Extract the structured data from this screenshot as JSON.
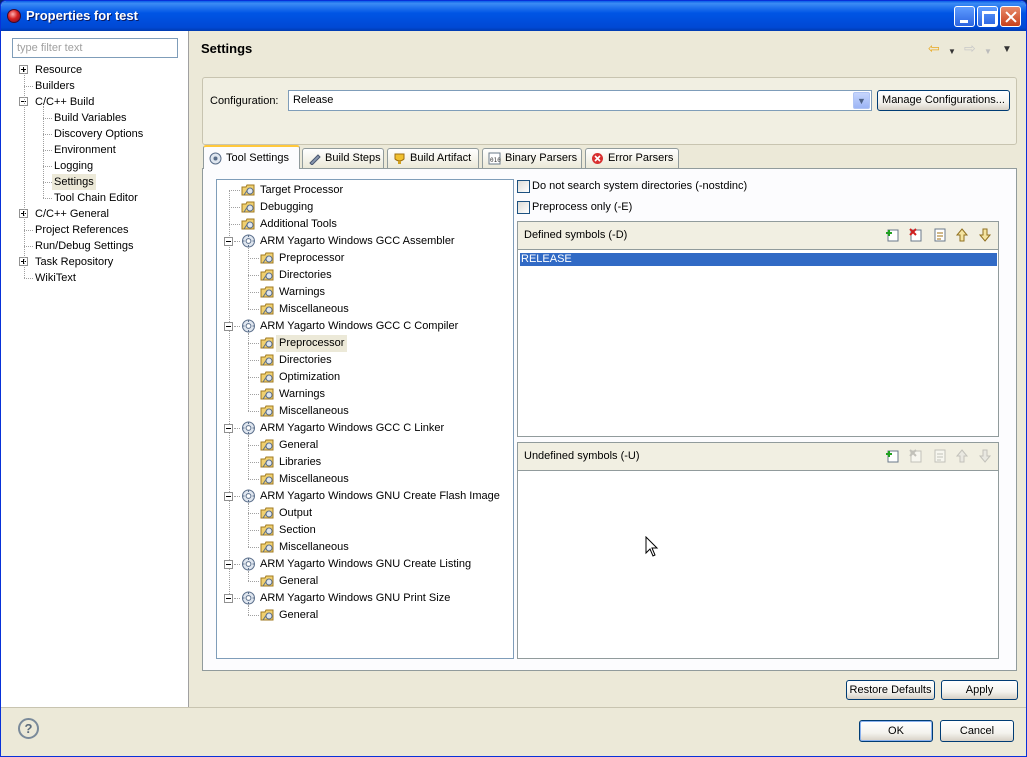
{
  "window": {
    "title": "Properties for test"
  },
  "filter": {
    "placeholder": "type filter text"
  },
  "left_tree": [
    {
      "label": "Resource",
      "level": 0,
      "expander": "plus"
    },
    {
      "label": "Builders",
      "level": 0,
      "expander": "none"
    },
    {
      "label": "C/C++ Build",
      "level": 0,
      "expander": "minus"
    },
    {
      "label": "Build Variables",
      "level": 1,
      "expander": "none"
    },
    {
      "label": "Discovery Options",
      "level": 1,
      "expander": "none"
    },
    {
      "label": "Environment",
      "level": 1,
      "expander": "none"
    },
    {
      "label": "Logging",
      "level": 1,
      "expander": "none"
    },
    {
      "label": "Settings",
      "level": 1,
      "expander": "none",
      "selected": true
    },
    {
      "label": "Tool Chain Editor",
      "level": 1,
      "expander": "none"
    },
    {
      "label": "C/C++ General",
      "level": 0,
      "expander": "plus"
    },
    {
      "label": "Project References",
      "level": 0,
      "expander": "none"
    },
    {
      "label": "Run/Debug Settings",
      "level": 0,
      "expander": "none"
    },
    {
      "label": "Task Repository",
      "level": 0,
      "expander": "plus"
    },
    {
      "label": "WikiText",
      "level": 0,
      "expander": "none"
    }
  ],
  "header": {
    "title": "Settings"
  },
  "config": {
    "label": "Configuration:",
    "value": "Release",
    "manage_button": "Manage Configurations..."
  },
  "tabs": [
    {
      "label": "Tool Settings",
      "icon": "tool-settings-icon",
      "active": true
    },
    {
      "label": "Build Steps",
      "icon": "build-steps-icon"
    },
    {
      "label": "Build Artifact",
      "icon": "build-artifact-icon"
    },
    {
      "label": "Binary Parsers",
      "icon": "binary-parsers-icon"
    },
    {
      "label": "Error Parsers",
      "icon": "error-parsers-icon"
    }
  ],
  "tool_tree": [
    {
      "label": "Target Processor",
      "level": 0,
      "kind": "option"
    },
    {
      "label": "Debugging",
      "level": 0,
      "kind": "option"
    },
    {
      "label": "Additional Tools",
      "level": 0,
      "kind": "option"
    },
    {
      "label": "ARM Yagarto Windows GCC Assembler",
      "level": 0,
      "kind": "tool"
    },
    {
      "label": "Preprocessor",
      "level": 1,
      "kind": "option"
    },
    {
      "label": "Directories",
      "level": 1,
      "kind": "option"
    },
    {
      "label": "Warnings",
      "level": 1,
      "kind": "option"
    },
    {
      "label": "Miscellaneous",
      "level": 1,
      "kind": "option"
    },
    {
      "label": "ARM Yagarto Windows GCC C Compiler",
      "level": 0,
      "kind": "tool"
    },
    {
      "label": "Preprocessor",
      "level": 1,
      "kind": "option",
      "selected": true
    },
    {
      "label": "Directories",
      "level": 1,
      "kind": "option"
    },
    {
      "label": "Optimization",
      "level": 1,
      "kind": "option"
    },
    {
      "label": "Warnings",
      "level": 1,
      "kind": "option"
    },
    {
      "label": "Miscellaneous",
      "level": 1,
      "kind": "option"
    },
    {
      "label": "ARM Yagarto Windows GCC C Linker",
      "level": 0,
      "kind": "tool"
    },
    {
      "label": "General",
      "level": 1,
      "kind": "option"
    },
    {
      "label": "Libraries",
      "level": 1,
      "kind": "option"
    },
    {
      "label": "Miscellaneous",
      "level": 1,
      "kind": "option"
    },
    {
      "label": "ARM Yagarto Windows GNU Create Flash Image",
      "level": 0,
      "kind": "tool"
    },
    {
      "label": "Output",
      "level": 1,
      "kind": "option"
    },
    {
      "label": "Section",
      "level": 1,
      "kind": "option"
    },
    {
      "label": "Miscellaneous",
      "level": 1,
      "kind": "option"
    },
    {
      "label": "ARM Yagarto Windows GNU Create Listing",
      "level": 0,
      "kind": "tool"
    },
    {
      "label": "General",
      "level": 1,
      "kind": "option"
    },
    {
      "label": "ARM Yagarto Windows GNU Print Size",
      "level": 0,
      "kind": "tool"
    },
    {
      "label": "General",
      "level": 1,
      "kind": "option"
    }
  ],
  "options": {
    "nostdinc_label": "Do not search system directories (-nostdinc)",
    "preprocess_only_label": "Preprocess only (-E)"
  },
  "defined_symbols": {
    "title": "Defined symbols (-D)",
    "items": [
      "RELEASE"
    ]
  },
  "undefined_symbols": {
    "title": "Undefined symbols (-U)",
    "items": []
  },
  "buttons": {
    "restore_defaults": "Restore Defaults",
    "apply": "Apply",
    "ok": "OK",
    "cancel": "Cancel"
  },
  "help": {
    "glyph": "?"
  },
  "colors": {
    "title_bar": "#0055e5",
    "selection": "#316ac5",
    "dialog_bg": "#ece9d8"
  }
}
